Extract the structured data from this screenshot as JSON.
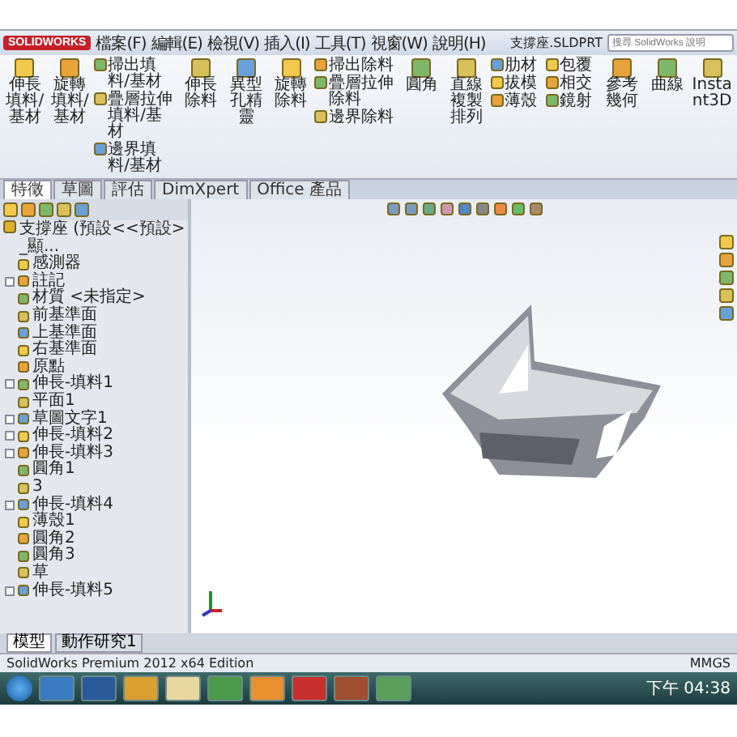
{
  "title_bar": {
    "logo": "SOLIDWORKS",
    "menus": [
      "檔案(F)",
      "編輯(E)",
      "檢視(V)",
      "插入(I)",
      "工具(T)",
      "視窗(W)",
      "說明(H)"
    ],
    "document_title": "支撐座.SLDPRT",
    "search": {
      "placeholder": "搜尋 SolidWorks 說明"
    }
  },
  "ribbon": [
    {
      "kind": "large",
      "label": "伸長填料/基材"
    },
    {
      "kind": "large",
      "label": "旋轉填料/基材"
    },
    {
      "kind": "stack",
      "labels": [
        "掃出填料/基材",
        "疊層拉伸填料/基材",
        "邊界填料/基材"
      ]
    },
    {
      "kind": "large",
      "label": "伸長除料"
    },
    {
      "kind": "large",
      "label": "異型孔精靈"
    },
    {
      "kind": "large",
      "label": "旋轉除料"
    },
    {
      "kind": "stack",
      "labels": [
        "掃出除料",
        "疊層拉伸除料",
        "邊界除料"
      ]
    },
    {
      "kind": "large",
      "label": "圓角"
    },
    {
      "kind": "large",
      "label": "直線複製排列"
    },
    {
      "kind": "stack",
      "labels": [
        "肋材",
        "拔模",
        "薄殼"
      ]
    },
    {
      "kind": "stack",
      "labels": [
        "包覆",
        "相交",
        "鏡射"
      ]
    },
    {
      "kind": "large",
      "label": "參考幾何"
    },
    {
      "kind": "large",
      "label": "曲線"
    },
    {
      "kind": "large",
      "label": "Instant3D"
    }
  ],
  "tabs": [
    {
      "label": "特徵",
      "selected": true
    },
    {
      "label": "草圖",
      "selected": false
    },
    {
      "label": "評估",
      "selected": false
    },
    {
      "label": "DimXpert",
      "selected": false
    },
    {
      "label": "Office 產品",
      "selected": false
    }
  ],
  "tree": {
    "root": "支撐座 (預設<<預設>_顯...",
    "items": [
      {
        "label": "感測器",
        "expandable": false
      },
      {
        "label": "註記",
        "expandable": true
      },
      {
        "label": "材質 <未指定>",
        "expandable": false
      },
      {
        "label": "前基準面",
        "expandable": false
      },
      {
        "label": "上基準面",
        "expandable": false
      },
      {
        "label": "右基準面",
        "expandable": false
      },
      {
        "label": "原點",
        "expandable": false
      },
      {
        "label": "伸長-填料1",
        "expandable": true
      },
      {
        "label": "平面1",
        "expandable": false
      },
      {
        "label": "草圖文字1",
        "expandable": true
      },
      {
        "label": "伸長-填料2",
        "expandable": true
      },
      {
        "label": "伸長-填料3",
        "expandable": true
      },
      {
        "label": "圓角1",
        "expandable": false
      },
      {
        "label": "3",
        "expandable": false
      },
      {
        "label": "伸長-填料4",
        "expandable": true
      },
      {
        "label": "薄殼1",
        "expandable": false
      },
      {
        "label": "圓角2",
        "expandable": false
      },
      {
        "label": "圓角3",
        "expandable": false
      },
      {
        "label": "草",
        "expandable": false
      },
      {
        "label": "伸長-填料5",
        "expandable": true
      }
    ]
  },
  "bottom_tabs": [
    {
      "label": "模型",
      "selected": true
    },
    {
      "label": "動作研究1",
      "selected": false
    }
  ],
  "status_bar": {
    "text": "SolidWorks Premium 2012 x64 Edition",
    "units": "MMGS"
  },
  "taskbar": {
    "clock": "下午 04:38"
  }
}
